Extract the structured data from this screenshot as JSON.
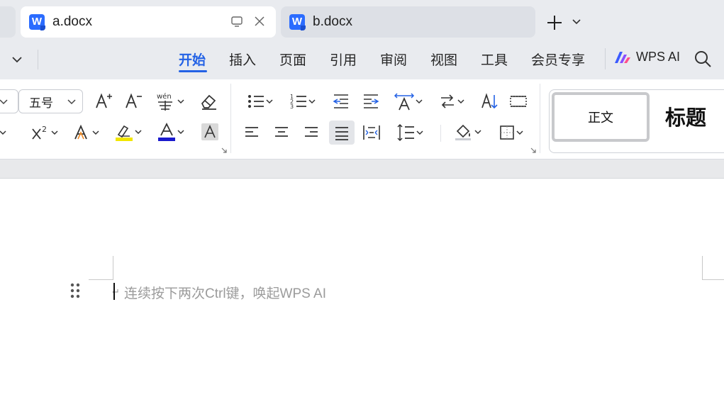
{
  "tabs": [
    {
      "label": "a.docx",
      "active": true,
      "icon": "wps-writer-icon",
      "logo_letter": "W"
    },
    {
      "label": "b.docx",
      "active": false,
      "icon": "wps-writer-icon",
      "logo_letter": "W"
    }
  ],
  "menu": {
    "items": [
      "开始",
      "插入",
      "页面",
      "引用",
      "审阅",
      "视图",
      "工具",
      "会员专享"
    ],
    "active_index": 0,
    "ai_label": "WPS AI"
  },
  "ribbon": {
    "font_size": "五号",
    "font_color": "#1a1acd",
    "highlight_color": "#f2e600",
    "styles": {
      "normal": "正文",
      "heading": "标题"
    }
  },
  "document": {
    "placeholder": "连续按下两次Ctrl键，唤起WPS AI"
  },
  "colors": {
    "accent": "#2462e5",
    "chrome": "#e9ebef",
    "logo": "#2b6cff"
  }
}
